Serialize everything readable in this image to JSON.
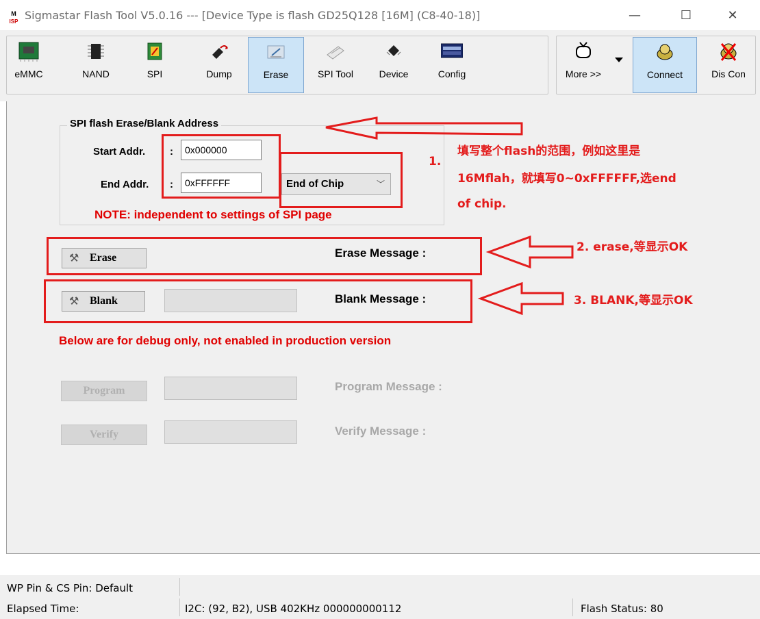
{
  "window": {
    "title": "Sigmastar Flash Tool V5.0.16 --- [Device Type is flash GD25Q128 [16M] (C8-40-18)]",
    "app_icon_text": "M\nISP",
    "minimize": "—",
    "maximize": "☐",
    "close": "✕"
  },
  "toolbar": {
    "emmc": "eMMC",
    "nand": "NAND",
    "spi": "SPI",
    "dump": "Dump",
    "erase": "Erase",
    "spi_tool": "SPI Tool",
    "device": "Device",
    "config": "Config",
    "more": "More >>",
    "connect": "Connect",
    "disconnect": "Dis Con",
    "active_tab": "Erase"
  },
  "form": {
    "group_title": "SPI flash Erase/Blank Address",
    "start_label": "Start Addr.",
    "start_value": "0x000000",
    "end_label": "End Addr.",
    "end_value": "0xFFFFFF",
    "colon": ":",
    "end_option": "End of Chip",
    "note": "NOTE: independent to settings of SPI page"
  },
  "actions": {
    "erase_label": "Erase",
    "erase_message": "Erase Message :",
    "blank_label": "Blank",
    "blank_message": "Blank Message :",
    "debug_note": "Below are for debug only, not enabled in production version",
    "program_label": "Program",
    "program_message": "Program Message :",
    "verify_label": "Verify",
    "verify_message": "Verify Message :"
  },
  "annotations": {
    "step1_num": "1.",
    "step1_line1": "填写整个flash的范围，例如这里是",
    "step1_line2": "16Mflah，就填写0~0xFFFFFF,选end",
    "step1_line3": "of chip.",
    "step2": "2. erase,等显示OK",
    "step3": "3. BLANK,等显示OK"
  },
  "status": {
    "wp_pin": "WP Pin & CS Pin: Default",
    "elapsed": "Elapsed Time:",
    "i2c": "I2C: (92, B2), USB  402KHz 000000000112",
    "flash_status": "Flash Status: 80"
  },
  "colors": {
    "annotation_red": "#e31c1c",
    "note_red": "#e00000",
    "active_tab_bg": "#cce4f7"
  }
}
